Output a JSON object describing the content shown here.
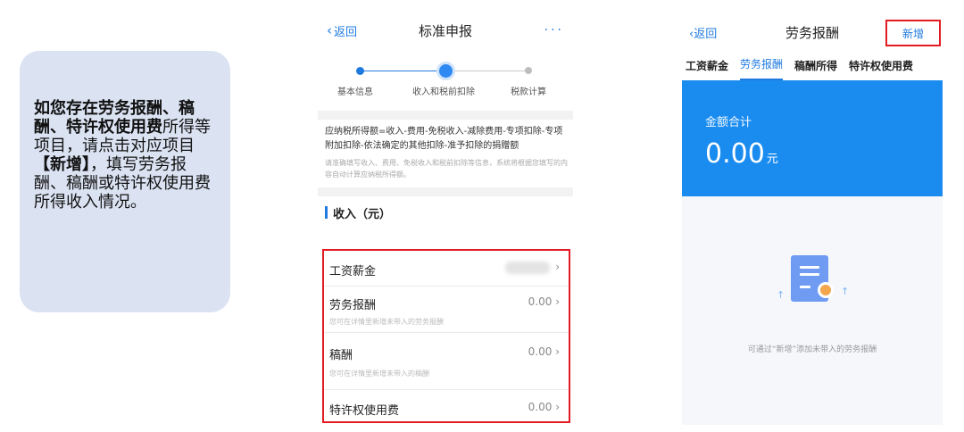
{
  "note": {
    "bold1": "如您存在劳务报酬、稿酬、特许权使用费",
    "plain1": "所得等项目，请点击对应项目",
    "bold2": "【新增】",
    "plain2": "，填写劳务报酬、稿酬或特许权使用费所得收入情况。"
  },
  "middle": {
    "back_label": "返回",
    "title": "标准申报",
    "more_label": "···",
    "steps": [
      "基本信息",
      "收入和税前扣除",
      "税款计算"
    ],
    "formula": "应纳税所得额=收入-费用-免税收入-减除费用-专项扣除-专项附加扣除-依法确定的其他扣除-准予扣除的捐赠额",
    "formula_note": "请准确填写收入、费用、免税收入和税前扣除等信息，系统将根据您填写的内容自动计算应纳税所得额。",
    "section_title": "收入（元）",
    "rows": [
      {
        "name": "工资薪金",
        "value": "",
        "hint": ""
      },
      {
        "name": "劳务报酬",
        "value": "0.00",
        "hint": "您可在详情里新增未带入的劳务报酬"
      },
      {
        "name": "稿酬",
        "value": "0.00",
        "hint": "您可在详情里新增未带入的稿酬"
      },
      {
        "name": "特许权使用费",
        "value": "0.00",
        "hint": ""
      }
    ]
  },
  "right": {
    "back_label": "返回",
    "title": "劳务报酬",
    "add_label": "新增",
    "tabs": [
      "工资薪金",
      "劳务报酬",
      "稿酬所得",
      "特许权使用费"
    ],
    "active_tab": "劳务报酬",
    "total_label": "金额合计",
    "total_amount": "0.00",
    "total_unit": "元",
    "empty_message": "可通过“新增”添加未带入的劳务报酬"
  },
  "colors": {
    "accent": "#1f7ae0",
    "highlight": "#e31c23",
    "panel": "#1a8cf0",
    "card": "#dbe3f3"
  }
}
